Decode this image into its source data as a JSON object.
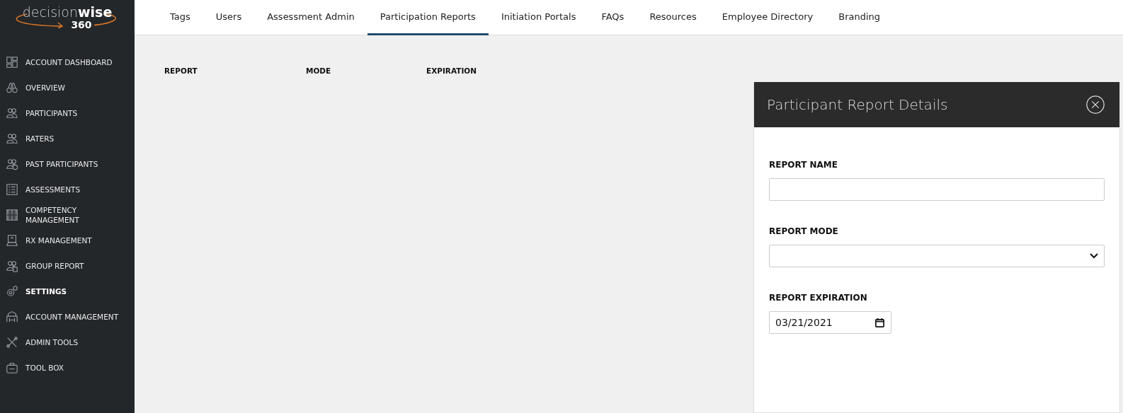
{
  "logo": {
    "word_light": "decision",
    "word_bold": "wise",
    "number": "360"
  },
  "sidebar": {
    "items": [
      {
        "label": "ACCOUNT DASHBOARD",
        "selected": false
      },
      {
        "label": "OVERVIEW",
        "selected": false
      },
      {
        "label": "PARTICIPANTS",
        "selected": false
      },
      {
        "label": "RATERS",
        "selected": false
      },
      {
        "label": "PAST PARTICIPANTS",
        "selected": false
      },
      {
        "label": "ASSESSMENTS",
        "selected": false
      },
      {
        "label": "COMPETENCY MANAGEMENT",
        "selected": false
      },
      {
        "label": "RX MANAGEMENT",
        "selected": false
      },
      {
        "label": "GROUP REPORT",
        "selected": false
      },
      {
        "label": "SETTINGS",
        "selected": true
      },
      {
        "label": "ACCOUNT MANAGEMENT",
        "selected": false
      },
      {
        "label": "ADMIN TOOLS",
        "selected": false
      },
      {
        "label": "TOOL BOX",
        "selected": false
      }
    ]
  },
  "tabs": [
    {
      "label": "Tags",
      "selected": false
    },
    {
      "label": "Users",
      "selected": false
    },
    {
      "label": "Assessment Admin",
      "selected": false
    },
    {
      "label": "Participation Reports",
      "selected": true
    },
    {
      "label": "Initiation Portals",
      "selected": false
    },
    {
      "label": "FAQs",
      "selected": false
    },
    {
      "label": "Resources",
      "selected": false
    },
    {
      "label": "Employee Directory",
      "selected": false
    },
    {
      "label": "Branding",
      "selected": false
    }
  ],
  "table": {
    "columns": [
      "REPORT",
      "MODE",
      "EXPIRATION"
    ]
  },
  "panel": {
    "title": "Participant Report Details",
    "fields": [
      {
        "label": "REPORT NAME",
        "kind": "text"
      },
      {
        "label": "REPORT MODE",
        "kind": "select"
      },
      {
        "label": "REPORT EXPIRATION",
        "kind": "date",
        "value": "03/21/2021"
      }
    ]
  }
}
